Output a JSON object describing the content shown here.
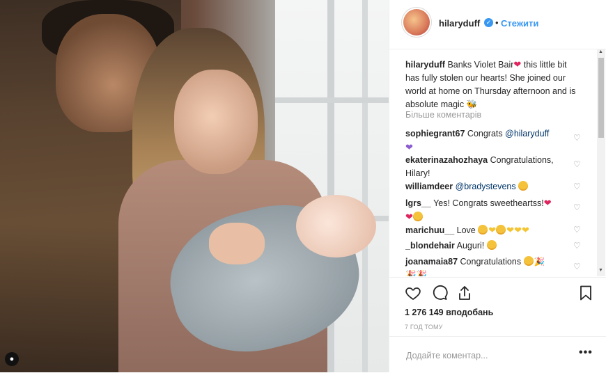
{
  "post": {
    "username": "hilaryduff",
    "follow_label": "Стежити",
    "separator": "•"
  },
  "caption": {
    "username": "hilaryduff",
    "text_before": "Banks Violet Bair",
    "text_after": " this little bit has fully stolen our hearts! She joined our world at home on Thursday afternoon and is absolute magic"
  },
  "more_comments_label": "Більше коментарів",
  "comments": [
    {
      "user": "sophiegrant67",
      "text": "Congrats ",
      "mention": "@hilaryduff",
      "emoji": "purple-heart"
    },
    {
      "user": "ekaterinazahozhaya",
      "text": "Congratulations, Hilary!"
    },
    {
      "user": "williamdeer",
      "text": "",
      "mention": "@bradystevens",
      "emoji": "heart-eyes"
    },
    {
      "user": "lgrs__",
      "text": "Yes! Congrats sweetheartss!",
      "emoji": "hearts"
    },
    {
      "user": "marichuu__",
      "text": "Love",
      "emoji": "hearts-mix"
    },
    {
      "user": "_blondehair",
      "text": "Auguri!",
      "emoji": "heart-eyes"
    },
    {
      "user": "joanamaia87",
      "text": "Congratulations",
      "emoji": "smile-party"
    }
  ],
  "likes": "1 276 149 вподобань",
  "time_ago": "7 год тому",
  "add_comment_placeholder": "Додайте коментар...",
  "more_options": "•••",
  "icons": {
    "like": "heart-outline-icon",
    "comment": "speech-bubble-icon",
    "share": "share-icon",
    "save": "bookmark-icon"
  },
  "colors": {
    "link": "#3897f0",
    "text": "#262626",
    "muted": "#999999",
    "heart_red": "#e0245e"
  }
}
